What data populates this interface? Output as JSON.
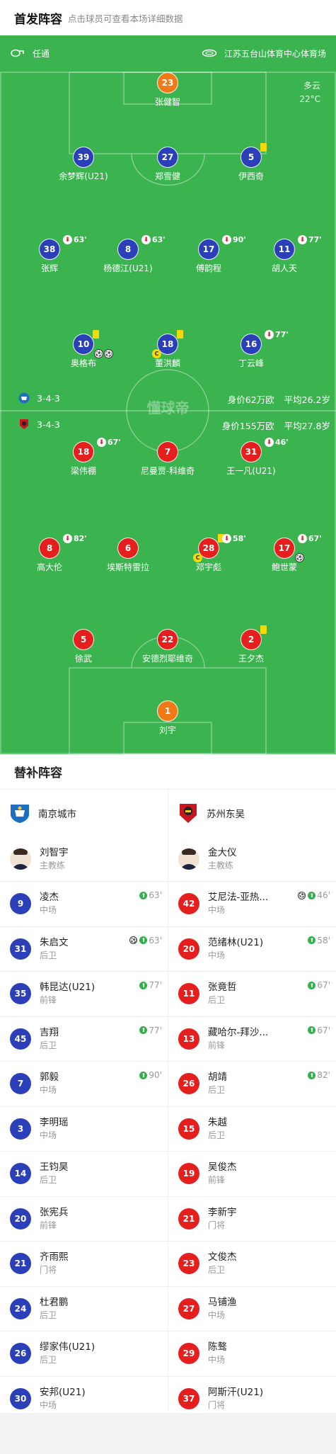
{
  "header": {
    "title": "首发阵容",
    "subtitle": "点击球员可查看本场详细数据"
  },
  "pitch": {
    "referee": "任通",
    "venue": "江苏五台山体育中心体育场",
    "weather": "多云",
    "temperature": "22°C",
    "watermark": "懂球帝",
    "colors": {
      "pitch": "#3bb34f",
      "blue": "#2b3fb8",
      "red": "#e51e1e",
      "orange": "#f07a18"
    },
    "home": {
      "formation": "3-4-3",
      "value": "身价62万欧",
      "age": "平均26.2岁"
    },
    "away": {
      "formation": "3-4-3",
      "value": "身价155万欧",
      "age": "平均27.8岁"
    }
  },
  "lineup": [
    {
      "num": "23",
      "name": "张健智",
      "color": "orange"
    },
    {
      "num": "39",
      "name": "余梦辉(U21)",
      "color": "blue"
    },
    {
      "num": "27",
      "name": "郑雪健",
      "color": "blue"
    },
    {
      "num": "5",
      "name": "伊西奇",
      "color": "blue",
      "yellow": true
    },
    {
      "num": "38",
      "name": "张辉",
      "color": "blue",
      "sub": "63'"
    },
    {
      "num": "8",
      "name": "杨德江(U21)",
      "color": "blue",
      "sub": "63'"
    },
    {
      "num": "17",
      "name": "傅韵程",
      "color": "blue",
      "sub": "90'"
    },
    {
      "num": "11",
      "name": "胡人天",
      "color": "blue",
      "sub": "77'"
    },
    {
      "num": "10",
      "name": "奥格布",
      "color": "blue",
      "yellow": true,
      "goals": 2
    },
    {
      "num": "18",
      "name": "董洪麟",
      "color": "blue",
      "yellow": true,
      "captain": true
    },
    {
      "num": "16",
      "name": "丁云峰",
      "color": "blue",
      "sub": "77'"
    },
    {
      "num": "18",
      "name": "梁伟棚",
      "color": "red",
      "sub": "67'"
    },
    {
      "num": "7",
      "name": "尼曼贾-科维奇",
      "color": "red"
    },
    {
      "num": "31",
      "name": "王一凡(U21)",
      "color": "red",
      "sub": "46'"
    },
    {
      "num": "8",
      "name": "高大伦",
      "color": "red",
      "sub": "82'"
    },
    {
      "num": "6",
      "name": "埃斯特雷拉",
      "color": "red"
    },
    {
      "num": "28",
      "name": "邓宇彪",
      "color": "red",
      "sub": "58'",
      "yellow": true,
      "captain": true
    },
    {
      "num": "17",
      "name": "鲍世蒙",
      "color": "red",
      "sub": "67'",
      "goals": 1
    },
    {
      "num": "5",
      "name": "徐武",
      "color": "red"
    },
    {
      "num": "22",
      "name": "安德烈耶维奇",
      "color": "red"
    },
    {
      "num": "2",
      "name": "王夕杰",
      "color": "red",
      "yellow": true
    },
    {
      "num": "1",
      "name": "刘宇",
      "color": "orange"
    }
  ],
  "subs_title": "替补阵容",
  "home_team": {
    "name": "南京城市",
    "coach_name": "刘智宇",
    "coach_role": "主教练"
  },
  "away_team": {
    "name": "苏州东吴",
    "coach_name": "金大仪",
    "coach_role": "主教练"
  },
  "home_subs": [
    {
      "num": "9",
      "name": "凌杰",
      "pos": "中场",
      "time": "63'"
    },
    {
      "num": "31",
      "name": "朱启文",
      "pos": "后卫",
      "time": "63'",
      "goal": true
    },
    {
      "num": "35",
      "name": "韩昆达(U21)",
      "pos": "前锋",
      "time": "77'"
    },
    {
      "num": "45",
      "name": "吉翔",
      "pos": "后卫",
      "time": "77'"
    },
    {
      "num": "7",
      "name": "郭毅",
      "pos": "中场",
      "time": "90'"
    },
    {
      "num": "3",
      "name": "李明瑶",
      "pos": "中场"
    },
    {
      "num": "14",
      "name": "王钧昊",
      "pos": "后卫"
    },
    {
      "num": "20",
      "name": "张宪兵",
      "pos": "前锋"
    },
    {
      "num": "21",
      "name": "齐雨熙",
      "pos": "门将"
    },
    {
      "num": "24",
      "name": "杜君鹏",
      "pos": "后卫"
    },
    {
      "num": "26",
      "name": "缪家伟(U21)",
      "pos": "后卫"
    },
    {
      "num": "30",
      "name": "安邦(U21)",
      "pos": "中场"
    }
  ],
  "away_subs": [
    {
      "num": "42",
      "name": "艾尼法-亚热...",
      "pos": "中场",
      "time": "46'",
      "goal": true
    },
    {
      "num": "20",
      "name": "范绪林(U21)",
      "pos": "中场",
      "time": "58'"
    },
    {
      "num": "11",
      "name": "张竟哲",
      "pos": "后卫",
      "time": "67'"
    },
    {
      "num": "13",
      "name": "藏哈尔-拜沙...",
      "pos": "前锋",
      "time": "67'"
    },
    {
      "num": "26",
      "name": "胡靖",
      "pos": "后卫",
      "time": "82'"
    },
    {
      "num": "15",
      "name": "朱越",
      "pos": "后卫"
    },
    {
      "num": "19",
      "name": "吴俊杰",
      "pos": "前锋"
    },
    {
      "num": "21",
      "name": "李新宇",
      "pos": "门将"
    },
    {
      "num": "23",
      "name": "文俊杰",
      "pos": "后卫"
    },
    {
      "num": "27",
      "name": "马铺渔",
      "pos": "中场"
    },
    {
      "num": "29",
      "name": "陈骜",
      "pos": "中场"
    },
    {
      "num": "37",
      "name": "阿斯汗(U21)",
      "pos": "门将"
    }
  ]
}
